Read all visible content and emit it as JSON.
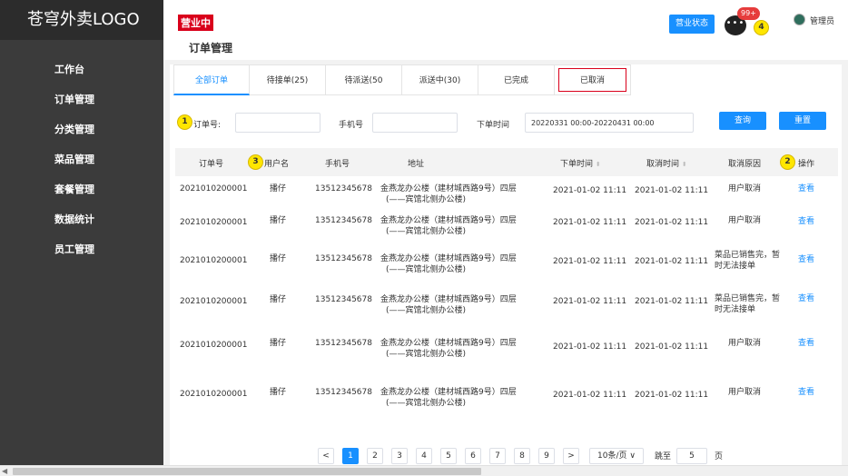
{
  "app": {
    "logo": "苍穹外卖LOGO"
  },
  "sidebar": {
    "items": [
      "工作台",
      "订单管理",
      "分类管理",
      "菜品管理",
      "套餐管理",
      "数据统计",
      "员工管理"
    ]
  },
  "header": {
    "status_tag": "营业中",
    "page_title": "订单管理",
    "biz_button": "营业状态",
    "msg_icon": "•••",
    "msg_badge": "99+",
    "admin_name": "管理员"
  },
  "markers": [
    "1",
    "2",
    "3",
    "4"
  ],
  "tabs": [
    "全部订单",
    "待接单(25)",
    "待派送(50",
    "派送中(30)",
    "已完成",
    "已取消"
  ],
  "filters": {
    "order_label": "订单号:",
    "phone_label": "手机号",
    "time_label": "下单时间",
    "time_value": "20220331 00:00-20220431 00:00",
    "search_btn": "查询",
    "reset_btn": "重置"
  },
  "table": {
    "headers": [
      "订单号",
      "用户名",
      "手机号",
      "地址",
      "下单时间",
      "取消时间",
      "取消原因",
      "操作"
    ],
    "sort_glyph": "⬍",
    "rows": [
      {
        "order": "2021010200001",
        "user": "播仔",
        "phone": "13512345678",
        "addr1": "金燕龙办公楼（建材城西路9号）四层",
        "addr2": "(——宾馆北侧办公楼)",
        "order_time": "2021-01-02 11:11",
        "cancel_time": "2021-01-02 11:11",
        "reason1": "用户取消",
        "reason2": "",
        "action": "查看"
      },
      {
        "order": "2021010200001",
        "user": "播仔",
        "phone": "13512345678",
        "addr1": "金燕龙办公楼（建材城西路9号）四层",
        "addr2": "(——宾馆北侧办公楼)",
        "order_time": "2021-01-02 11:11",
        "cancel_time": "2021-01-02 11:11",
        "reason1": "用户取消",
        "reason2": "",
        "action": "查看"
      },
      {
        "order": "2021010200001",
        "user": "播仔",
        "phone": "13512345678",
        "addr1": "金燕龙办公楼（建材城西路9号）四层",
        "addr2": "(——宾馆北侧办公楼)",
        "order_time": "2021-01-02 11:11",
        "cancel_time": "2021-01-02 11:11",
        "reason1": "菜品已销售完，暂",
        "reason2": "时无法接单",
        "action": "查看"
      },
      {
        "order": "2021010200001",
        "user": "播仔",
        "phone": "13512345678",
        "addr1": "金燕龙办公楼（建材城西路9号）四层",
        "addr2": "(——宾馆北侧办公楼)",
        "order_time": "2021-01-02 11:11",
        "cancel_time": "2021-01-02 11:11",
        "reason1": "菜品已销售完，暂",
        "reason2": "时无法接单",
        "action": "查看"
      },
      {
        "order": "2021010200001",
        "user": "播仔",
        "phone": "13512345678",
        "addr1": "金燕龙办公楼（建材城西路9号）四层",
        "addr2": "(——宾馆北侧办公楼)",
        "order_time": "2021-01-02 11:11",
        "cancel_time": "2021-01-02 11:11",
        "reason1": "用户取消",
        "reason2": "",
        "action": "查看"
      },
      {
        "order": "2021010200001",
        "user": "播仔",
        "phone": "13512345678",
        "addr1": "金燕龙办公楼（建材城西路9号）四层",
        "addr2": "(——宾馆北侧办公楼)",
        "order_time": "2021-01-02 11:11",
        "cancel_time": "2021-01-02 11:11",
        "reason1": "用户取消",
        "reason2": "",
        "action": "查看"
      }
    ]
  },
  "pagination": {
    "prev": "<",
    "pages": [
      "1",
      "2",
      "3",
      "4",
      "5",
      "6",
      "7",
      "8",
      "9"
    ],
    "next": ">",
    "page_size": "10条/页 ∨",
    "jump_label": "跳至",
    "jump_value": "5",
    "page_unit": "页"
  },
  "colors": {
    "accent": "#1890ff",
    "status_red": "#d9001b",
    "sidebar_bg": "#3b3b3b"
  }
}
